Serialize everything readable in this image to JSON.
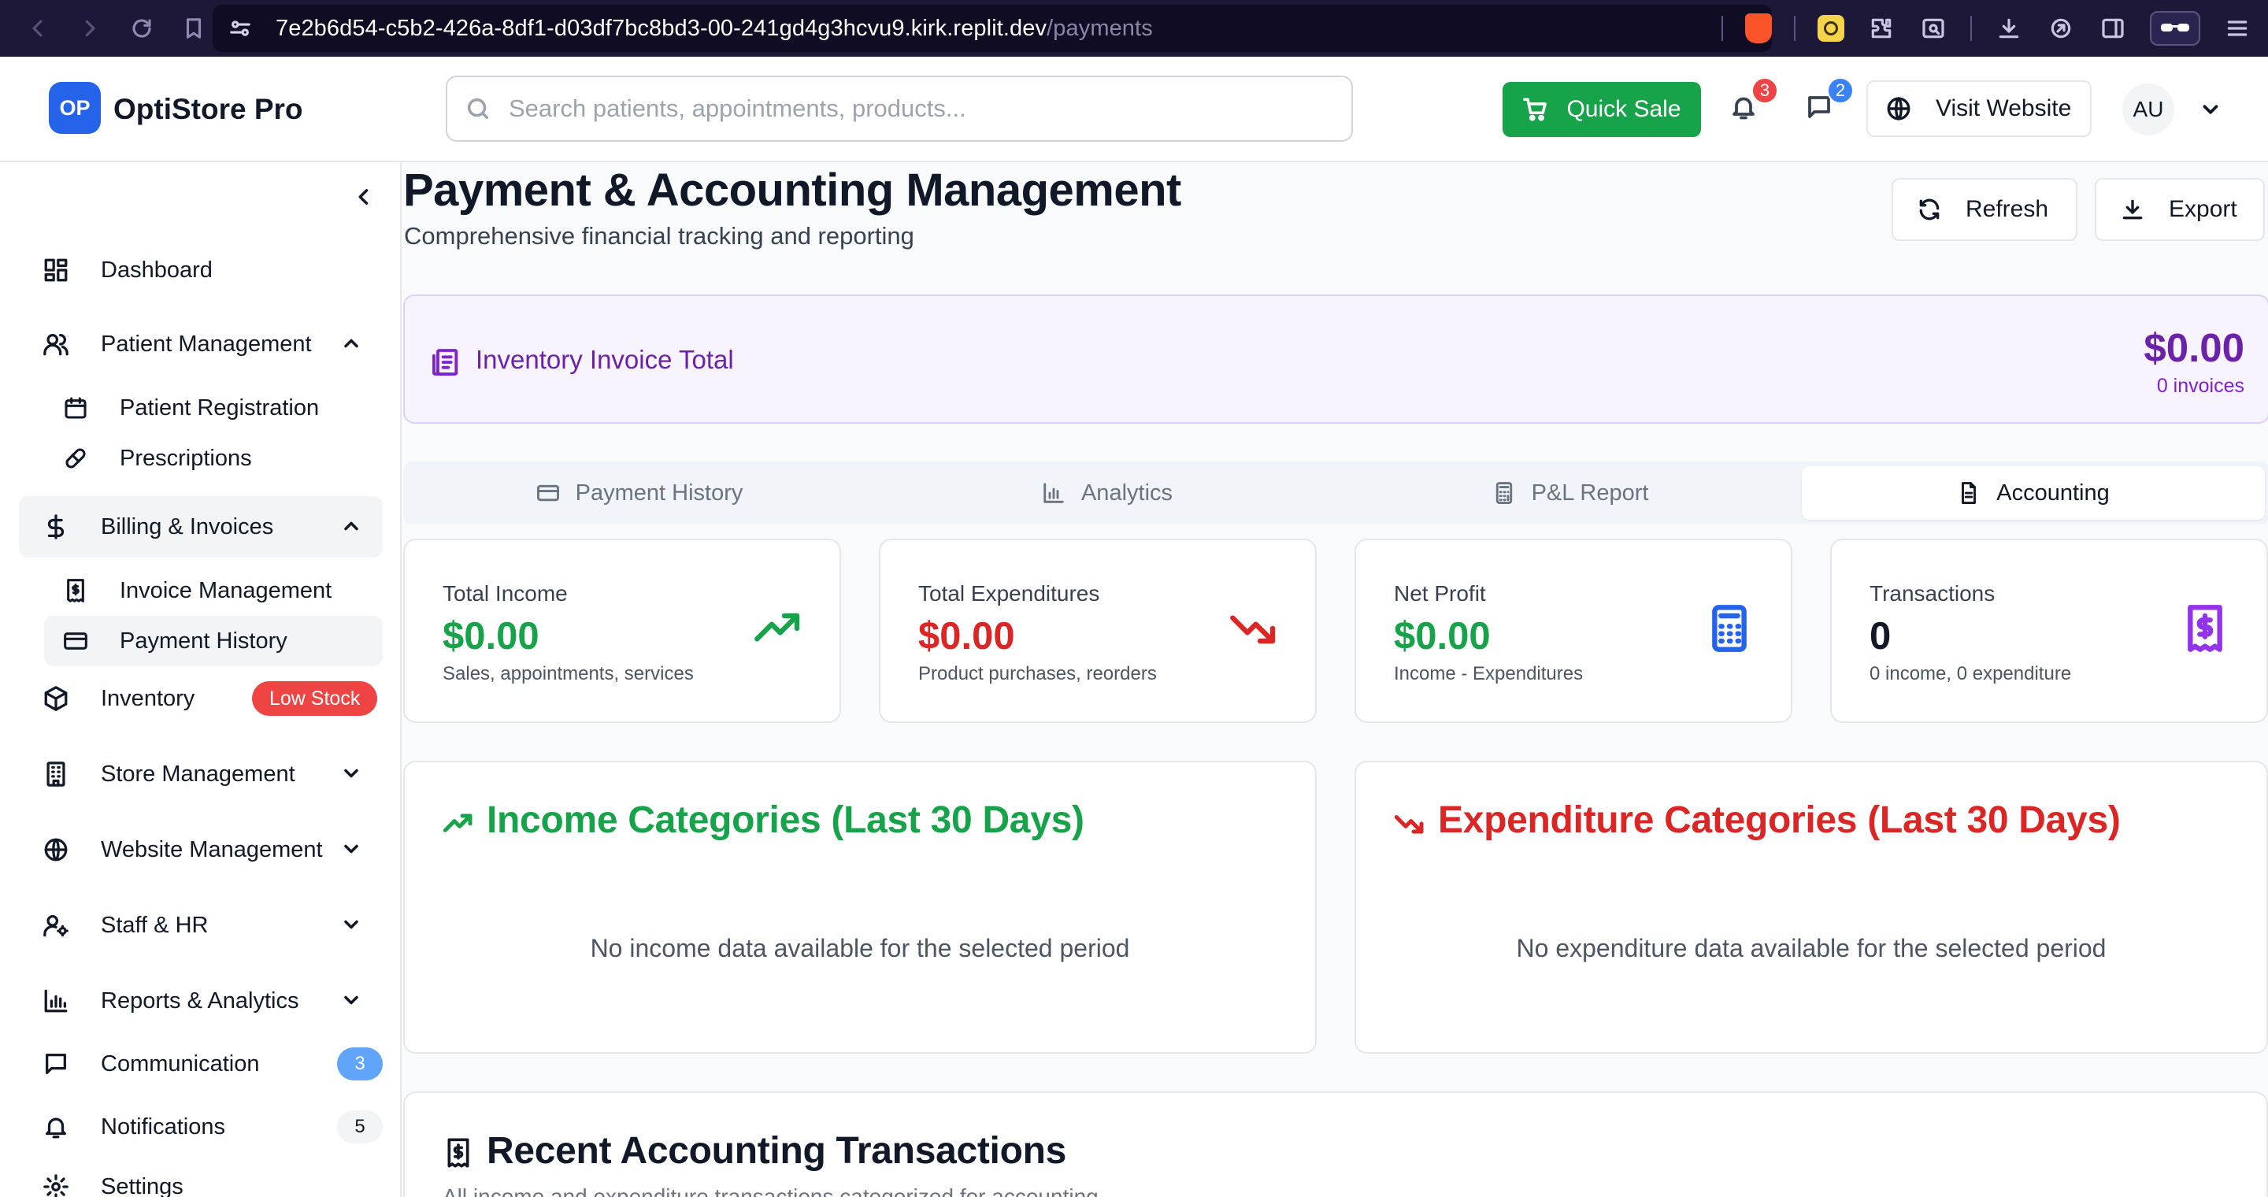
{
  "browser": {
    "url_host": "7e2b6d54-c5b2-426a-8df1-d03df7bc8bd3-00-241gd4g3hcvu9.kirk.replit.dev",
    "url_path": "/payments"
  },
  "header": {
    "logo_initials": "OP",
    "app_name": "OptiStore Pro",
    "search_placeholder": "Search patients, appointments, products...",
    "quick_sale_label": "Quick Sale",
    "notifications_count": "3",
    "messages_count": "2",
    "visit_website_label": "Visit Website",
    "user_initials": "AU"
  },
  "sidebar": {
    "items": [
      {
        "label": "Dashboard",
        "icon": "dashboard-icon"
      },
      {
        "label": "Patient Management",
        "icon": "users-icon",
        "expanded": true
      },
      {
        "label": "Patient Registration",
        "icon": "calendar-icon"
      },
      {
        "label": "Prescriptions",
        "icon": "pill-icon"
      },
      {
        "label": "Billing & Invoices",
        "icon": "dollar-icon",
        "expanded": true
      },
      {
        "label": "Invoice Management",
        "icon": "receipt-icon"
      },
      {
        "label": "Payment History",
        "icon": "credit-card-icon"
      },
      {
        "label": "Inventory",
        "icon": "package-icon",
        "badge": "Low Stock"
      },
      {
        "label": "Store Management",
        "icon": "building-icon"
      },
      {
        "label": "Website Management",
        "icon": "globe-icon"
      },
      {
        "label": "Staff & HR",
        "icon": "user-cog-icon"
      },
      {
        "label": "Reports & Analytics",
        "icon": "bar-chart-icon"
      },
      {
        "label": "Communication",
        "icon": "message-icon",
        "badge": "3"
      },
      {
        "label": "Notifications",
        "icon": "bell-icon",
        "badge": "5"
      },
      {
        "label": "Settings",
        "icon": "gear-icon"
      }
    ]
  },
  "page": {
    "title": "Payment & Accounting Management",
    "subtitle": "Comprehensive financial tracking and reporting",
    "refresh_label": "Refresh",
    "export_label": "Export"
  },
  "inventory_invoice": {
    "label": "Inventory Invoice Total",
    "amount": "$0.00",
    "count": "0 invoices"
  },
  "tabs": [
    {
      "label": "Payment History",
      "active": false
    },
    {
      "label": "Analytics",
      "active": false
    },
    {
      "label": "P&L Report",
      "active": false
    },
    {
      "label": "Accounting",
      "active": true
    }
  ],
  "stats": [
    {
      "label": "Total Income",
      "value": "$0.00",
      "sub": "Sales, appointments, services",
      "color": "#16a34a",
      "icon": "trending-up-icon"
    },
    {
      "label": "Total Expenditures",
      "value": "$0.00",
      "sub": "Product purchases, reorders",
      "color": "#dc2626",
      "icon": "trending-down-icon"
    },
    {
      "label": "Net Profit",
      "value": "$0.00",
      "sub": "Income - Expenditures",
      "color": "#16a34a",
      "icon": "calculator-icon"
    },
    {
      "label": "Transactions",
      "value": "0",
      "sub": "0 income, 0 expenditure",
      "color": "#111827",
      "icon": "receipt-icon"
    }
  ],
  "income_categories": {
    "title": "Income Categories (Last 30 Days)",
    "empty": "No income data available for the selected period"
  },
  "expenditure_categories": {
    "title": "Expenditure Categories (Last 30 Days)",
    "empty": "No expenditure data available for the selected period"
  },
  "recent_transactions": {
    "title": "Recent Accounting Transactions",
    "description": "All income and expenditure transactions categorized for accounting"
  },
  "colors": {
    "primary": "#2563eb",
    "success": "#16a34a",
    "danger": "#dc2626",
    "purple": "#6b21a8"
  }
}
